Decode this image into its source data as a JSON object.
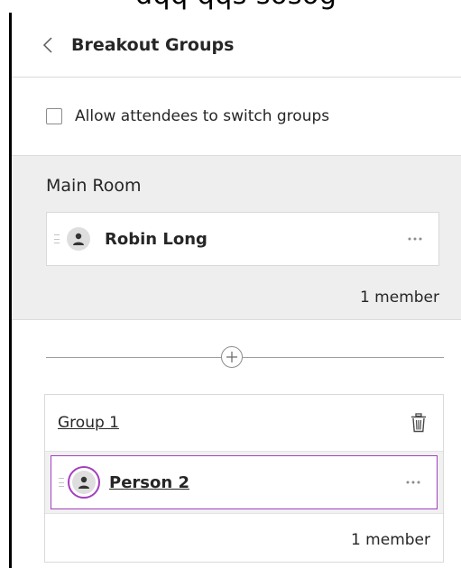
{
  "header": {
    "title": "Breakout Groups"
  },
  "settings": {
    "allow_switch_label": "Allow attendees to switch groups",
    "allow_switch_checked": false
  },
  "main_room": {
    "title": "Main Room",
    "members": [
      {
        "name": "Robin Long"
      }
    ],
    "member_count": "1 member"
  },
  "groups": [
    {
      "name": "Group 1",
      "members": [
        {
          "name": "Person 2"
        }
      ],
      "member_count": "1 member"
    }
  ],
  "icons": {
    "back": "chevron-left-icon",
    "avatar": "user-icon",
    "more": "more-horizontal-icon",
    "add": "plus-circle-icon",
    "delete": "trash-icon",
    "drag": "drag-handle-icon"
  },
  "colors": {
    "main_room_bg": "#eeeeee",
    "selected_border": "#a33fbf",
    "divider": "#d9d9d9",
    "text": "#262626"
  }
}
